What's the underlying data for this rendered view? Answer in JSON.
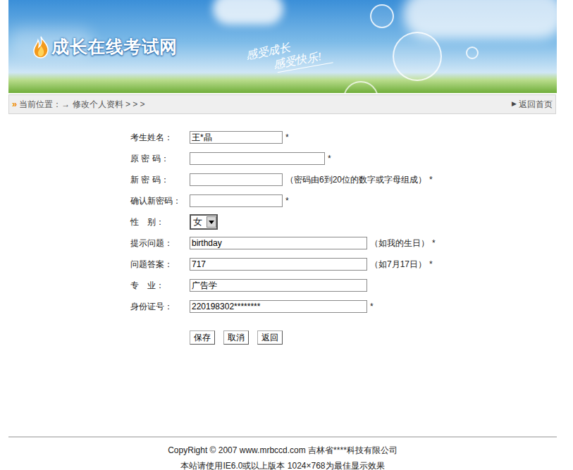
{
  "header": {
    "logo": "成长在线考试网",
    "slogan": [
      "感受成长",
      "感受快乐!"
    ]
  },
  "breadcrumb": {
    "icon": "»",
    "prefix": "当前位置：",
    "arrow": "→",
    "page": "修改个人资料",
    "trail": "> > >",
    "home_icon": "▶",
    "home": "返回首页"
  },
  "form": {
    "fields": [
      {
        "label": "考生姓名：",
        "kind": "text",
        "value": "王*晶",
        "hint": "",
        "mark": "*"
      },
      {
        "label": "原 密 码：",
        "kind": "password",
        "value": "",
        "hint": "",
        "mark": "*"
      },
      {
        "label": "新 密 码：",
        "kind": "password",
        "value": "",
        "hint": "（密码由6到20位的数字或字母组成）",
        "mark": "*"
      },
      {
        "label": "确认新密码：",
        "kind": "password",
        "value": "",
        "hint": "",
        "mark": "*"
      },
      {
        "label": "性　别：",
        "kind": "select",
        "value": "女",
        "hint": "",
        "mark": ""
      },
      {
        "label": "提示问题：",
        "kind": "text",
        "value": "birthday",
        "hint": "（如我的生日）",
        "mark": "*"
      },
      {
        "label": "问题答案：",
        "kind": "text",
        "value": "717",
        "hint": "（如7月17日）",
        "mark": "*"
      },
      {
        "label": "专　业：",
        "kind": "text",
        "value": "广告学",
        "hint": "",
        "mark": ""
      },
      {
        "label": "身份证号：",
        "kind": "text",
        "value": "220198302********",
        "hint": "",
        "mark": "*"
      }
    ]
  },
  "buttons": [
    "保存",
    "取消",
    "返回"
  ],
  "footer": {
    "copyright": "CopyRight © 2007 www.mrbccd.com 吉林省****科技有限公司",
    "notice": "本站请使用IE6.0或以上版本 1024×768为最佳显示效果"
  }
}
